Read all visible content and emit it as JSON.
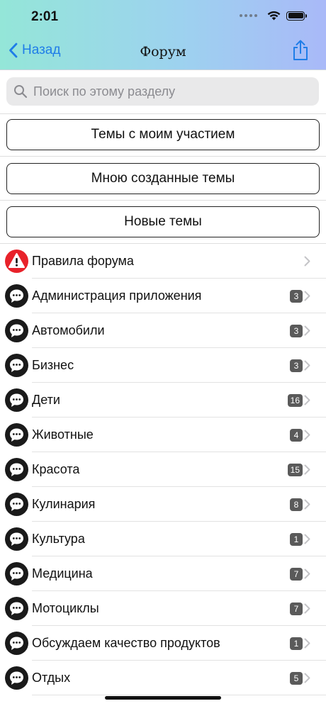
{
  "status": {
    "time": "2:01"
  },
  "nav": {
    "back_label": "Назад",
    "title": "Форум"
  },
  "search": {
    "placeholder": "Поиск по этому разделу"
  },
  "buttons": {
    "my_topics": "Темы с моим участием",
    "created_topics": "Мною созданные темы",
    "new_topics": "Новые темы"
  },
  "colors": {
    "accent": "#1f7de8",
    "warning": "#e8222a",
    "badge": "#5a5a5a"
  },
  "forum": {
    "rules": {
      "label": "Правила форума",
      "icon": "warning-icon"
    },
    "sections": [
      {
        "label": "Администрация приложения",
        "count": "3"
      },
      {
        "label": "Автомобили",
        "count": "3"
      },
      {
        "label": "Бизнес",
        "count": "3"
      },
      {
        "label": "Дети",
        "count": "16"
      },
      {
        "label": "Животные",
        "count": "4"
      },
      {
        "label": "Красота",
        "count": "15"
      },
      {
        "label": "Кулинария",
        "count": "8"
      },
      {
        "label": "Культура",
        "count": "1"
      },
      {
        "label": "Медицина",
        "count": "7"
      },
      {
        "label": "Мотоциклы",
        "count": "7"
      },
      {
        "label": "Обсуждаем качество продуктов",
        "count": "1"
      },
      {
        "label": "Отдых",
        "count": "5"
      }
    ]
  }
}
